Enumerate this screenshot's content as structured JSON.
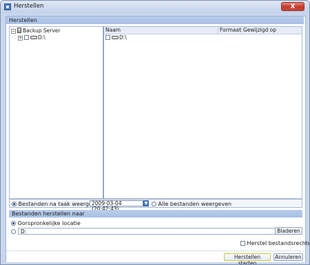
{
  "window": {
    "title": "Herstellen",
    "close_symbol": "X"
  },
  "restore_section": {
    "header": "Herstellen",
    "tree": {
      "root_label": "Backup Server",
      "root_expander": "−",
      "child_label": "D:\\",
      "child_expander": "+"
    },
    "files": {
      "columns": [
        "Naam",
        "Formaat",
        "Gewijzigd op"
      ],
      "rows": [
        {
          "name": "D:\\"
        }
      ]
    },
    "filter": {
      "option_by_job": "Bestanden na taak weergeven",
      "selected_date": "2009-03-04 (20:42:43)",
      "option_all": "Alle bestanden weergeven"
    }
  },
  "destination_section": {
    "header": "Bestanden herstellen naar",
    "option_original": "Oorspronkelijke locatie",
    "path_value": "D:",
    "browse_label": "Bladeren",
    "restore_permissions_label": "Herstel bestandsrechten"
  },
  "actions": {
    "start_label": "Herstellen starten",
    "cancel_label": "Annuleren"
  },
  "colors": {
    "accent": "#4d7fbf",
    "header_bg": "#a8c0e6",
    "start_button_border": "#c7c73e"
  },
  "icons": {
    "app": "app-window-icon",
    "server": "server-icon",
    "drive": "hard-drive-icon",
    "close": "close-icon",
    "dropdown": "chevron-down-icon"
  }
}
